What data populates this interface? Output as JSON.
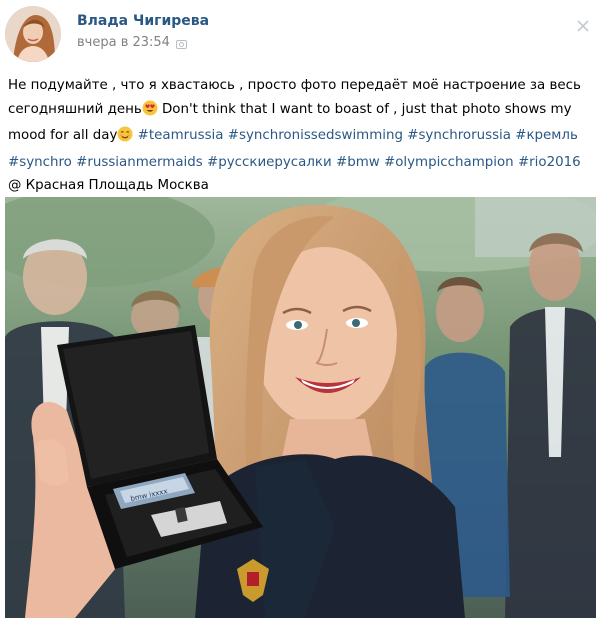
{
  "post": {
    "author": "Влада Чигирева",
    "time": "вчера в 23:54",
    "text_ru_1": "Не подумайте , что я хвастаюсь , просто фото передаёт моё настроение за весь сегодняшний день",
    "text_en_1": " Don't think that I want to boast of , just that photo shows my mood for all day",
    "hashtags": [
      "#teamrussia",
      "#synchronissedswimming",
      "#synchrorussia",
      "#кремль",
      "#synchro",
      "#russianmermaids",
      "#русскиерусалки",
      "#bmw",
      "#olympicchampion",
      "#rio2016"
    ],
    "location_prefix": " @",
    "location": "Красная Площадь Москва",
    "box_label": "bmw ixxxx"
  },
  "icons": {
    "camera": "camera-icon",
    "more": "more-icon",
    "emoji_heart_eyes": "heart-eyes-emoji-icon",
    "emoji_smile": "smile-emoji-icon"
  },
  "colors": {
    "link": "#2a5885",
    "meta": "#828282",
    "emoji": "#f7c53a"
  }
}
